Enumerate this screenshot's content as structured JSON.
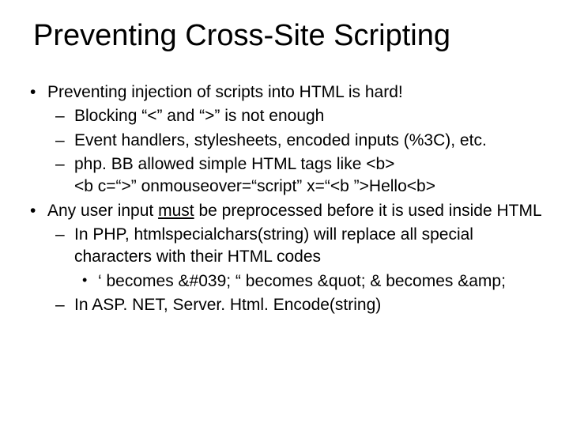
{
  "slide": {
    "title": "Preventing Cross-Site Scripting",
    "b1": {
      "text": "Preventing injection of scripts into HTML is hard!",
      "s1": "Blocking “<” and “>” is not enough",
      "s2": "Event handlers, stylesheets, encoded inputs (%3C), etc.",
      "s3a": "php. BB allowed simple HTML tags like <b>",
      "s3b": "<b c=“>” onmouseover=“script” x=“<b ”>Hello<b>"
    },
    "b2": {
      "pre": "Any user input ",
      "must": "must",
      "post": " be preprocessed before it is used inside HTML",
      "s1": "In PHP, htmlspecialchars(string) will replace all special characters with their HTML codes",
      "s1a": "‘ becomes &#039;  “ becomes &quot; & becomes &amp;",
      "s2": "In ASP. NET, Server. Html. Encode(string)"
    }
  }
}
